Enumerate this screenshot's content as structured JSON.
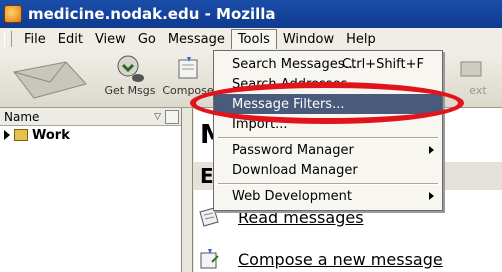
{
  "window": {
    "title": "medicine.nodak.edu - Mozilla"
  },
  "menubar": {
    "items": [
      "File",
      "Edit",
      "View",
      "Go",
      "Message",
      "Tools",
      "Window",
      "Help"
    ]
  },
  "toolbar": {
    "get_msgs_label": "Get Msgs",
    "compose_label": "Compose",
    "right_label_fragment": "ext"
  },
  "folder_pane": {
    "column_header": "Name",
    "folders": [
      {
        "name": "Work"
      }
    ]
  },
  "main": {
    "heading_fragment": "M",
    "section_fragment": "E",
    "links": [
      {
        "label": "Read messages"
      },
      {
        "label": "Compose a new message"
      }
    ]
  },
  "tools_menu": {
    "items": [
      {
        "label": "Search Messages...",
        "shortcut": "Ctrl+Shift+F",
        "submenu": false
      },
      {
        "label": "Search Addresses...",
        "submenu": false
      },
      {
        "label": "Message Filters...",
        "submenu": false,
        "highlighted": true
      },
      {
        "label": "Import...",
        "submenu": false
      },
      {
        "label": "Password Manager",
        "submenu": true
      },
      {
        "label": "Download Manager",
        "submenu": false
      },
      {
        "label": "Web Development",
        "submenu": true
      }
    ]
  },
  "colors": {
    "titlebar": "#1b4eaa",
    "highlight": "#4a5a7a",
    "annotation_ring": "#e1141b"
  }
}
